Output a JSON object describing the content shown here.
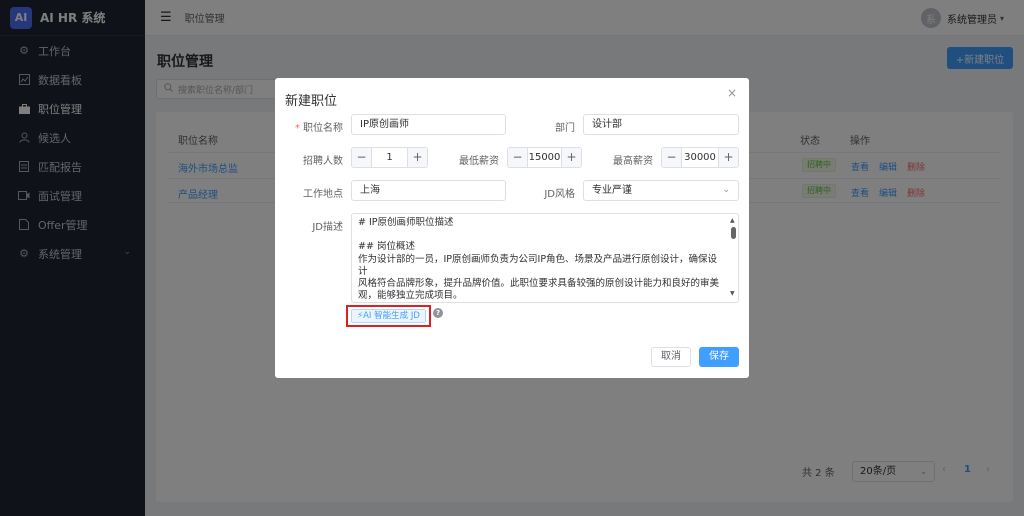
{
  "brand": {
    "logo": "AI",
    "name": "AI HR 系统"
  },
  "sidebar": {
    "items": [
      {
        "label": "工作台",
        "icon": "gear-icon"
      },
      {
        "label": "数据看板",
        "icon": "chart-icon"
      },
      {
        "label": "职位管理",
        "icon": "briefcase-icon"
      },
      {
        "label": "候选人",
        "icon": "user-icon"
      },
      {
        "label": "匹配报告",
        "icon": "document-icon"
      },
      {
        "label": "面试管理",
        "icon": "video-icon"
      },
      {
        "label": "Offer管理",
        "icon": "doc-icon"
      },
      {
        "label": "系统管理",
        "icon": "settings-icon"
      }
    ]
  },
  "header": {
    "breadcrumb": "职位管理",
    "avatar": "系",
    "user_name": "系统管理员"
  },
  "page": {
    "title": "职位管理",
    "new_button": "+新建职位",
    "search_placeholder": "搜索职位名称/部门"
  },
  "table": {
    "headers": {
      "name": "职位名称",
      "status": "状态",
      "ops": "操作"
    },
    "rows": [
      {
        "name": "海外市场总监",
        "status": "招聘中"
      },
      {
        "name": "产品经理",
        "status": "招聘中"
      }
    ],
    "ops": {
      "view": "查看",
      "edit": "编辑",
      "delete": "删除"
    }
  },
  "pagination": {
    "total": "共 2 条",
    "page_size": "20条/页",
    "prev": "‹",
    "current": "1",
    "next": "›"
  },
  "dialog": {
    "title": "新建职位",
    "close": "×",
    "labels": {
      "name": "职位名称",
      "dept": "部门",
      "headcount": "招聘人数",
      "min_salary": "最低薪资",
      "max_salary": "最高薪资",
      "location": "工作地点",
      "jd_style": "JD风格",
      "jd": "JD描述"
    },
    "values": {
      "name": "IP原创画师",
      "dept": "设计部",
      "headcount": "1",
      "min_salary": "15000",
      "max_salary": "30000",
      "location": "上海",
      "jd_style": "专业严谨"
    },
    "jd_lines": [
      "# IP原创画师职位描述",
      "",
      "## 岗位概述",
      "作为设计部的一员，IP原创画师负责为公司IP角色、场景及产品进行原创设计，确保设计",
      "风格符合品牌形象，提升品牌价值。此职位要求具备较强的原创设计能力和良好的审美",
      "观，能够独立完成项目。"
    ],
    "ai_button": "AI 智能生成 JD",
    "help": "?",
    "cancel": "取消",
    "save": "保存"
  }
}
